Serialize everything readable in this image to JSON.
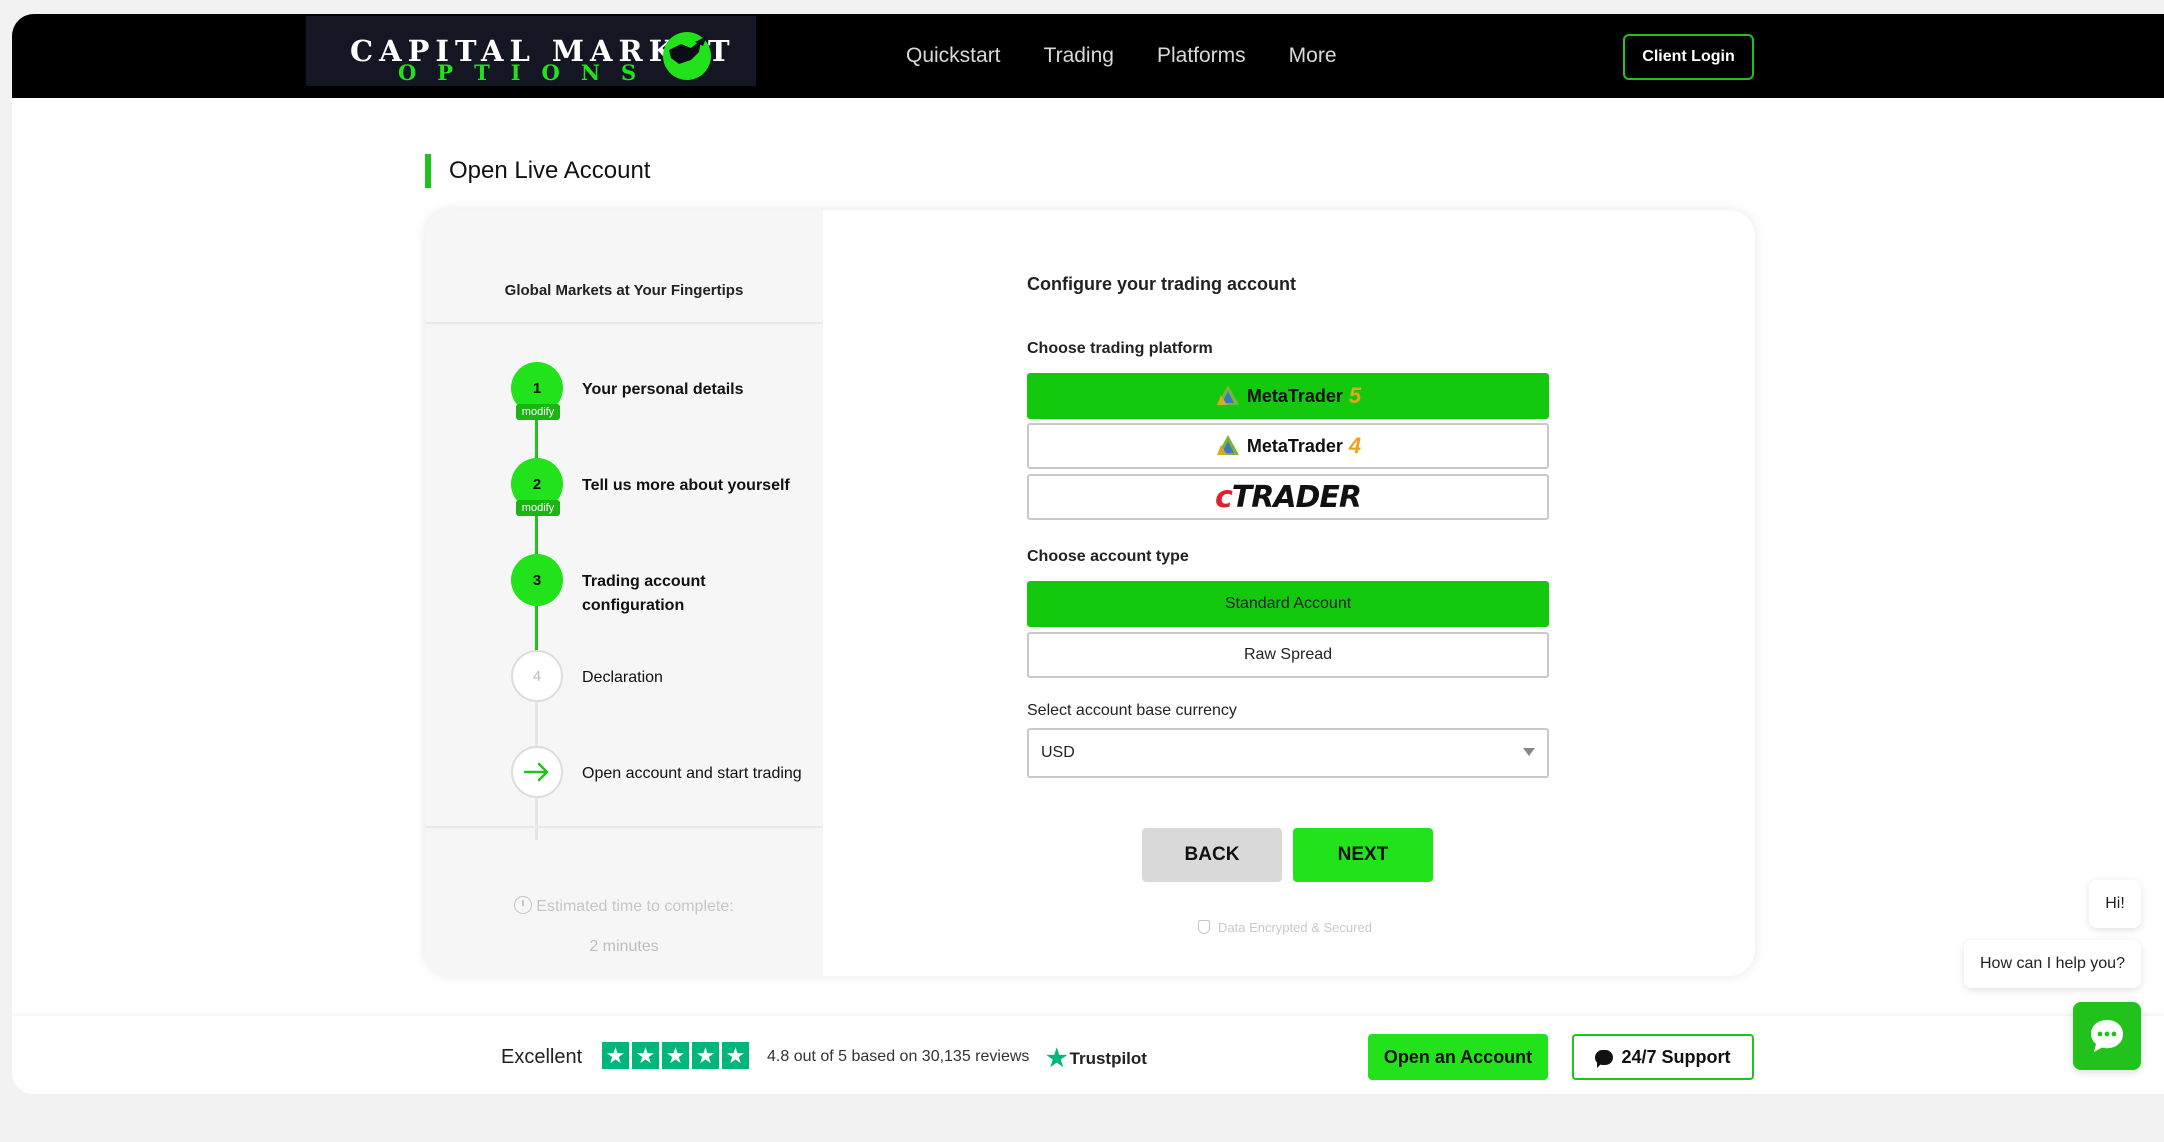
{
  "brand": {
    "line1": "CAPITAL MARKET",
    "line2": "OPTIONS",
    "accent": "#22e21c"
  },
  "nav": {
    "items": [
      "Quickstart",
      "Trading",
      "Platforms",
      "More"
    ],
    "client_login": "Client Login"
  },
  "page": {
    "title": "Open Live Account"
  },
  "sidebar": {
    "title": "Global Markets at Your Fingertips",
    "modify_label": "modify",
    "steps": [
      {
        "number": "1",
        "label": "Your personal details",
        "status": "done"
      },
      {
        "number": "2",
        "label": "Tell us more about yourself",
        "status": "done"
      },
      {
        "number": "3",
        "label": "Trading account configuration",
        "status": "current"
      },
      {
        "number": "4",
        "label": "Declaration",
        "status": "todo"
      },
      {
        "number": "",
        "label": "Open account and start trading",
        "status": "todo",
        "icon": "arrow-right-icon"
      }
    ],
    "estimated_label": "Estimated time to complete:",
    "estimated_value": "2 minutes"
  },
  "form": {
    "title": "Configure your trading account",
    "platform_label": "Choose trading platform",
    "platforms": [
      {
        "name": "MetaTrader",
        "version": "5",
        "selected": true
      },
      {
        "name": "MetaTrader",
        "version": "4",
        "selected": false
      },
      {
        "name": "cTrader",
        "selected": false
      }
    ],
    "ctrader_logo": {
      "c": "c",
      "rest": "TRADER"
    },
    "account_type_label": "Choose account type",
    "account_types": [
      {
        "label": "Standard Account",
        "selected": true
      },
      {
        "label": "Raw Spread",
        "selected": false
      }
    ],
    "currency_label": "Select account base currency",
    "currency_value": "USD",
    "back_label": "BACK",
    "next_label": "NEXT",
    "secure_text": "Data Encrypted & Secured"
  },
  "footer": {
    "excellent": "Excellent",
    "rating_text": "4.8 out of 5 based on 30,135 reviews",
    "trustpilot": "Trustpilot",
    "open_account": "Open an Account",
    "support": "24/7 Support"
  },
  "chat": {
    "hi": "Hi!",
    "help": "How can I help you?"
  }
}
